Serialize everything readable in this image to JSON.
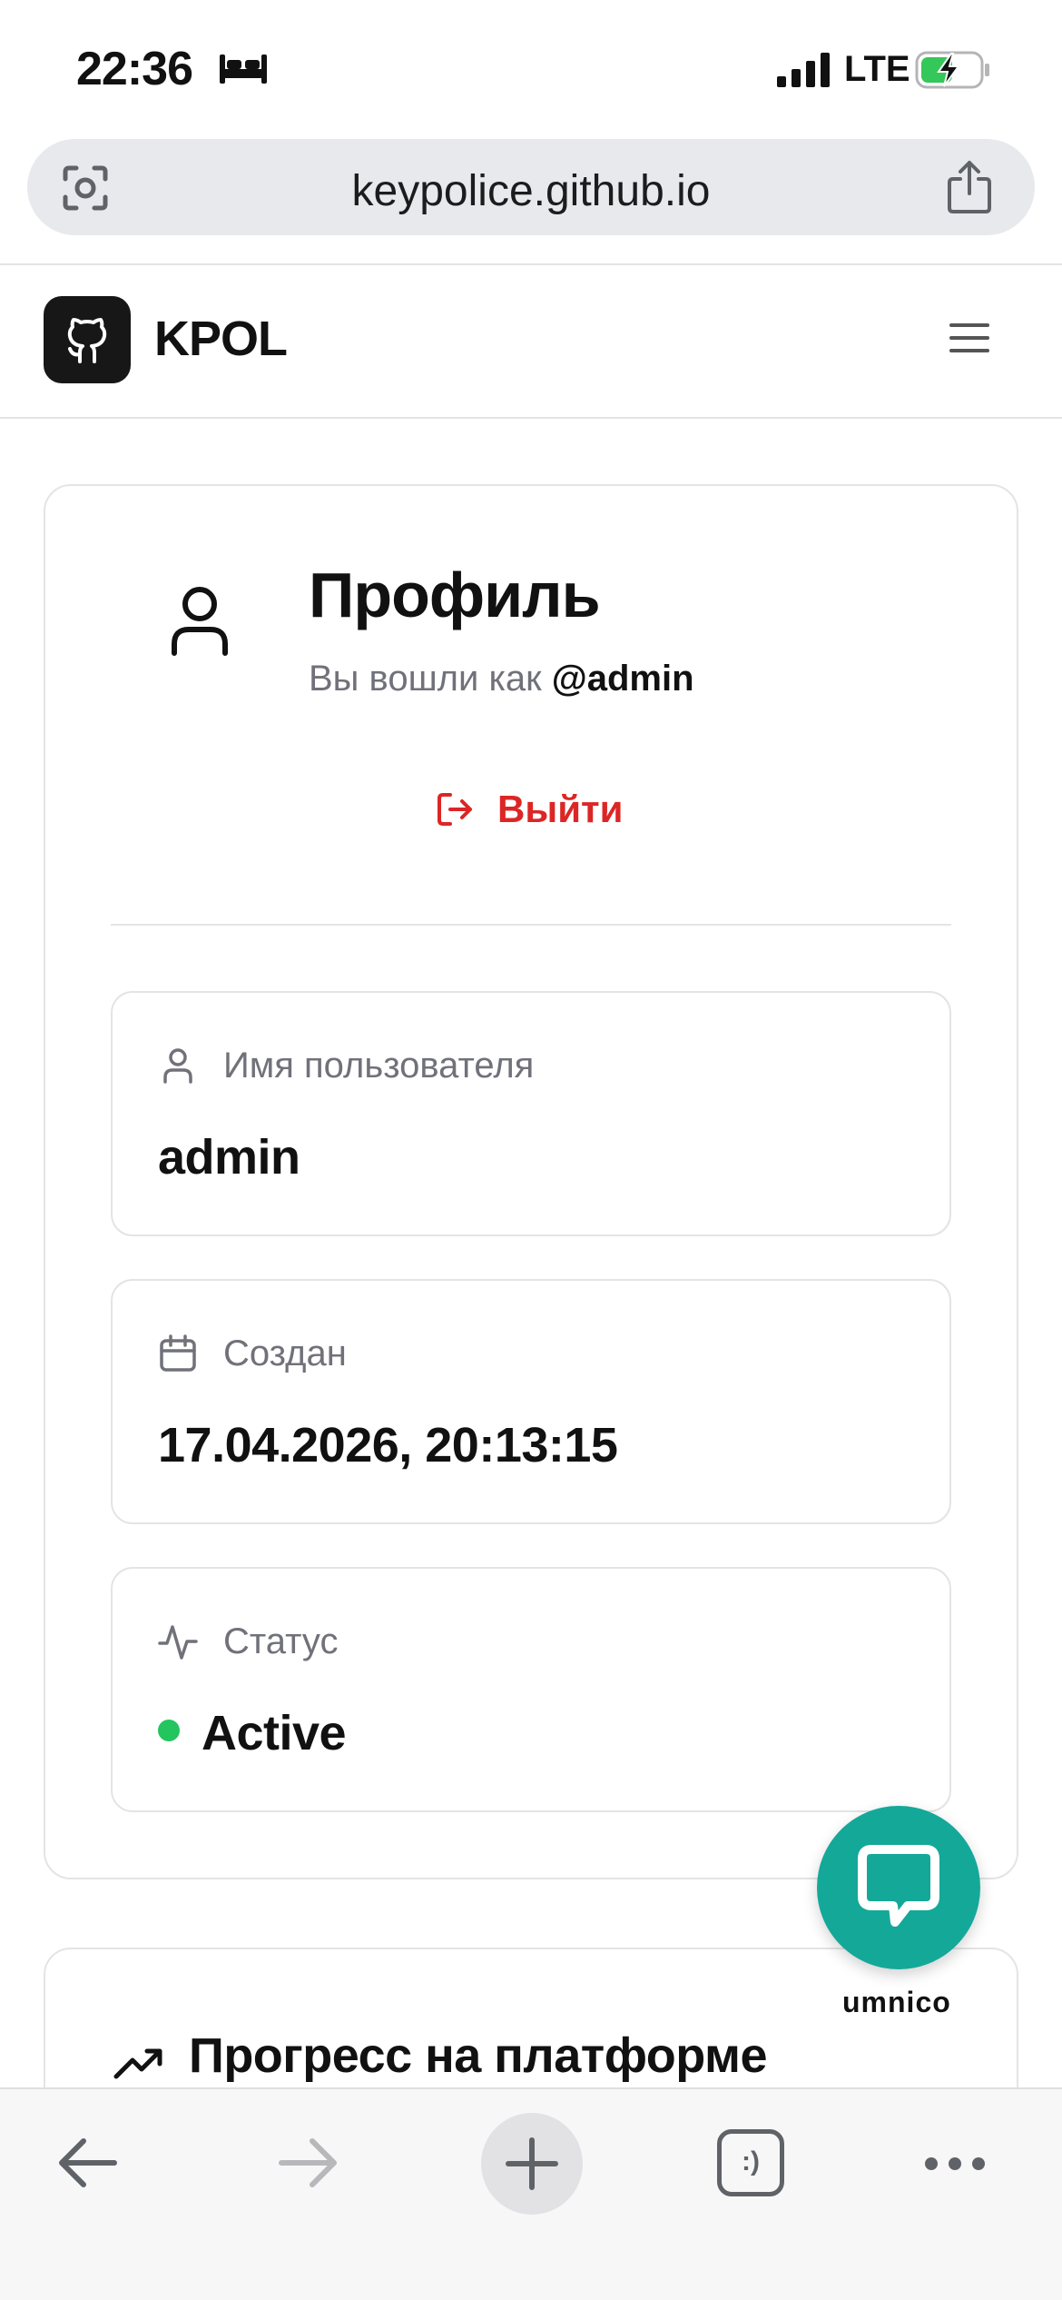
{
  "status_bar": {
    "time": "22:36",
    "network": "LTE",
    "icons": [
      "bed-icon",
      "signal-icon",
      "battery-charging-icon"
    ]
  },
  "browser": {
    "url": "keypolice.github.io",
    "icons": [
      "camera-search-icon",
      "share-icon"
    ]
  },
  "site_header": {
    "logo_icon": "github-icon",
    "name": "KPOL",
    "menu_icon": "hamburger-menu-icon"
  },
  "profile": {
    "title": "Профиль",
    "logged_in_prefix": "Вы вошли как",
    "handle": "@admin",
    "logout_label": "Выйти",
    "fields": [
      {
        "icon": "user-icon",
        "label": "Имя пользователя",
        "value": "admin"
      },
      {
        "icon": "calendar-icon",
        "label": "Создан",
        "value": "17.04.2026, 20:13:15"
      },
      {
        "icon": "activity-icon",
        "label": "Статус",
        "value": "Active"
      }
    ],
    "colors": {
      "logout": "#dc2626",
      "status_active": "#22c55e"
    }
  },
  "progress": {
    "title": "Прогресс на платформе",
    "icon": "trending-up-icon"
  },
  "chat_widget": {
    "brand": "umnico",
    "color": "#14a899",
    "icon": "chat-bubble-icon"
  },
  "toolbar": {
    "tabs_label": ":)",
    "icons": [
      "back-arrow-icon",
      "forward-arrow-icon",
      "plus-icon",
      "tabs-icon",
      "more-icon"
    ]
  }
}
